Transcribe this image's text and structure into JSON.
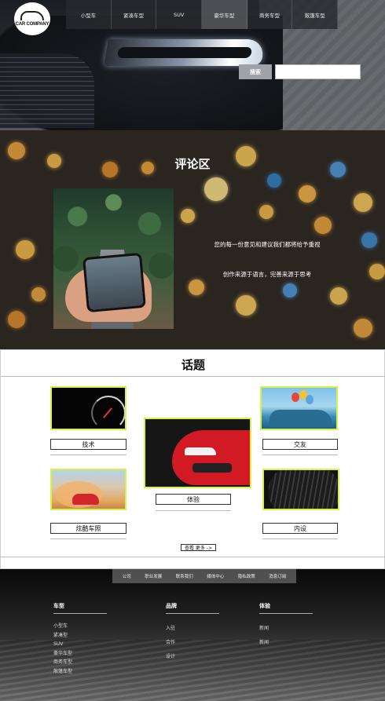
{
  "logo": {
    "text": "CAR COMPANY"
  },
  "nav": {
    "items": [
      {
        "label": "小型车"
      },
      {
        "label": "紧凑车型"
      },
      {
        "label": "SUV"
      },
      {
        "label": "豪华车型"
      },
      {
        "label": "商务车型"
      },
      {
        "label": "敞篷车型"
      }
    ],
    "active_index": 3
  },
  "search": {
    "button_label": "搜索",
    "placeholder": "",
    "value": ""
  },
  "comments": {
    "title": "评论区",
    "line1": "您的每一份意见和建议我们都将给予重视",
    "line2": "创作来源于语言，完善来源于思考"
  },
  "topics": {
    "title": "话题",
    "cards": [
      {
        "label": "技术",
        "image": "speedometer"
      },
      {
        "label": "交友",
        "image": "car-with-balloons"
      },
      {
        "label": "体验",
        "image": "red-car-front"
      },
      {
        "label": "炫酷车照",
        "image": "drifting-car"
      },
      {
        "label": "内设",
        "image": "tire"
      }
    ],
    "more_label": "查看 更多 ->"
  },
  "footer": {
    "links": [
      "公司",
      "职业发展",
      "联系我们",
      "媒体中心",
      "隐私政策",
      "消息订阅"
    ],
    "columns": [
      {
        "heading": "车型",
        "items": [
          "小型车",
          "紧凑型",
          "SUV",
          "豪华车型",
          "商务车型",
          "敞篷车型"
        ]
      },
      {
        "heading": "品牌",
        "items": [
          "入驻",
          "合作",
          "设计"
        ]
      },
      {
        "heading": "体验",
        "items": [
          "新闻",
          "新闻"
        ]
      }
    ]
  },
  "colors": {
    "card_border": "#d4f247",
    "nav_bg": "#2a2c2e",
    "search_button": "#9fa2a6"
  }
}
